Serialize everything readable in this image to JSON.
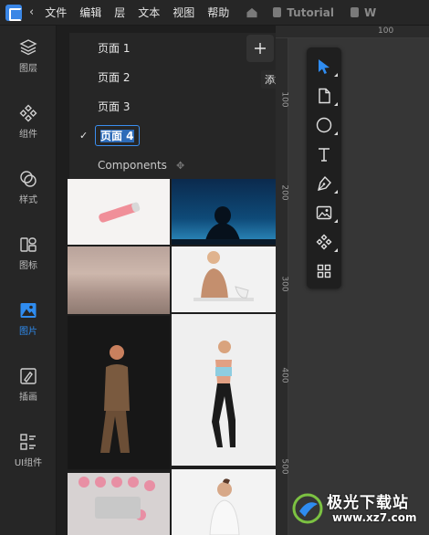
{
  "menu": [
    "文件",
    "编辑",
    "层",
    "文本",
    "视图",
    "帮助"
  ],
  "tabs": [
    "Tutorial",
    "W"
  ],
  "sidebar": [
    {
      "label": "图层",
      "icon": "layers-icon"
    },
    {
      "label": "组件",
      "icon": "components-icon"
    },
    {
      "label": "样式",
      "icon": "styles-icon"
    },
    {
      "label": "图标",
      "icon": "icons-icon"
    },
    {
      "label": "图片",
      "icon": "image-icon",
      "active": true
    },
    {
      "label": "插画",
      "icon": "illustration-icon"
    },
    {
      "label": "UI组件",
      "icon": "ui-components-icon"
    }
  ],
  "pages": {
    "items": [
      "页面 1",
      "页面 2",
      "页面 3",
      "页面 4"
    ],
    "active_index": 3,
    "components_label": "Components",
    "add_tooltip": "添加页面"
  },
  "ruler": {
    "top": [
      "100"
    ],
    "left": [
      "100",
      "200",
      "300",
      "400",
      "500"
    ]
  },
  "toolbar": [
    "move-tool-icon",
    "page-tool-icon",
    "ellipse-tool-icon",
    "text-tool-icon",
    "pen-tool-icon",
    "image-tool-icon",
    "component-tool-icon",
    "grid-tool-icon"
  ],
  "colors": {
    "accent": "#2f8cf0",
    "panel": "#262626",
    "canvas": "#363636"
  },
  "watermark": {
    "title": "极光下载站",
    "url": "www.xz7.com"
  }
}
